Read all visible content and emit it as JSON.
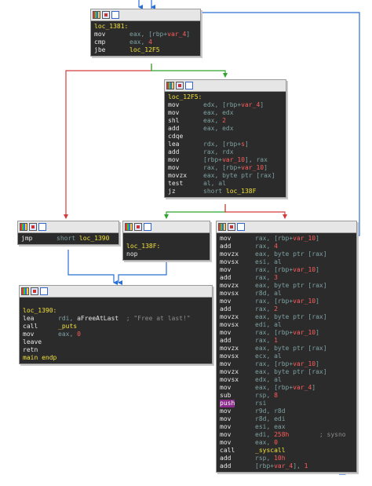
{
  "blocks": [
    {
      "id": "loc_1381",
      "lines": [
        {
          "t": "label",
          "text": "loc_1381:"
        },
        {
          "m": "mov",
          "o": [
            [
              "op",
              "eax, [rbp+"
            ],
            [
              "vr",
              "var_4"
            ],
            [
              "op",
              "]"
            ]
          ]
        },
        {
          "m": "cmp",
          "o": [
            [
              "op",
              "eax, "
            ],
            [
              "nm",
              "4"
            ]
          ]
        },
        {
          "m": "jbe",
          "o": [
            [
              "fn",
              "loc_12F5"
            ]
          ]
        }
      ]
    },
    {
      "id": "loc_12F5",
      "lines": [
        {
          "t": "label",
          "text": "loc_12F5:"
        },
        {
          "m": "mov",
          "o": [
            [
              "op",
              "edx, [rbp+"
            ],
            [
              "vr",
              "var_4"
            ],
            [
              "op",
              "]"
            ]
          ]
        },
        {
          "m": "mov",
          "o": [
            [
              "op",
              "eax, edx"
            ]
          ]
        },
        {
          "m": "shl",
          "o": [
            [
              "op",
              "eax, "
            ],
            [
              "nm",
              "2"
            ]
          ]
        },
        {
          "m": "add",
          "o": [
            [
              "op",
              "eax, edx"
            ]
          ]
        },
        {
          "m": "cdqe",
          "o": []
        },
        {
          "m": "lea",
          "o": [
            [
              "op",
              "rdx, [rbp+"
            ],
            [
              "vr",
              "s"
            ],
            [
              "op",
              "]"
            ]
          ]
        },
        {
          "m": "add",
          "o": [
            [
              "op",
              "rax, rdx"
            ]
          ]
        },
        {
          "m": "mov",
          "o": [
            [
              "op",
              "[rbp+"
            ],
            [
              "vr",
              "var_10"
            ],
            [
              "op",
              "], rax"
            ]
          ]
        },
        {
          "m": "mov",
          "o": [
            [
              "op",
              "rax, [rbp+"
            ],
            [
              "vr",
              "var_10"
            ],
            [
              "op",
              "]"
            ]
          ]
        },
        {
          "m": "movzx",
          "o": [
            [
              "op",
              "eax, byte ptr [rax]"
            ]
          ]
        },
        {
          "m": "test",
          "o": [
            [
              "op",
              "al, al"
            ]
          ]
        },
        {
          "m": "jz",
          "o": [
            [
              "op",
              "short "
            ],
            [
              "fn",
              "loc_138F"
            ]
          ]
        }
      ]
    },
    {
      "id": "jmp_1390",
      "lines": [
        {
          "m": "jmp",
          "o": [
            [
              "op",
              "short "
            ],
            [
              "fn",
              "loc_1390"
            ]
          ]
        }
      ]
    },
    {
      "id": "loc_138F",
      "lines": [
        {
          "t": "blank"
        },
        {
          "t": "label",
          "text": "loc_138F:"
        },
        {
          "m": "nop",
          "o": []
        }
      ]
    },
    {
      "id": "loc_1390",
      "lines": [
        {
          "t": "blank"
        },
        {
          "t": "label",
          "text": "loc_1390:"
        },
        {
          "m": "lea",
          "o": [
            [
              "op",
              "rdi, "
            ],
            [
              "st",
              "aFreeAtLast"
            ],
            [
              "cm",
              "  ; \"Free at last!\""
            ]
          ]
        },
        {
          "m": "call",
          "o": [
            [
              "fn",
              "_puts"
            ]
          ]
        },
        {
          "m": "mov",
          "o": [
            [
              "op",
              "eax, "
            ],
            [
              "nm",
              "0"
            ]
          ]
        },
        {
          "m": "leave",
          "o": []
        },
        {
          "m": "retn",
          "o": []
        },
        {
          "t": "label",
          "text": "main endp"
        }
      ]
    },
    {
      "id": "syscall_block",
      "lines": [
        {
          "m": "mov",
          "o": [
            [
              "op",
              "rax, [rbp+"
            ],
            [
              "vr",
              "var_10"
            ],
            [
              "op",
              "]"
            ]
          ]
        },
        {
          "m": "add",
          "o": [
            [
              "op",
              "rax, "
            ],
            [
              "nm",
              "4"
            ]
          ]
        },
        {
          "m": "movzx",
          "o": [
            [
              "op",
              "eax, byte ptr [rax]"
            ]
          ]
        },
        {
          "m": "movsx",
          "o": [
            [
              "op",
              "esi, al"
            ]
          ]
        },
        {
          "m": "mov",
          "o": [
            [
              "op",
              "rax, [rbp+"
            ],
            [
              "vr",
              "var_10"
            ],
            [
              "op",
              "]"
            ]
          ]
        },
        {
          "m": "add",
          "o": [
            [
              "op",
              "rax, "
            ],
            [
              "nm",
              "3"
            ]
          ]
        },
        {
          "m": "movzx",
          "o": [
            [
              "op",
              "eax, byte ptr [rax]"
            ]
          ]
        },
        {
          "m": "movsx",
          "o": [
            [
              "op",
              "r8d, al"
            ]
          ]
        },
        {
          "m": "mov",
          "o": [
            [
              "op",
              "rax, [rbp+"
            ],
            [
              "vr",
              "var_10"
            ],
            [
              "op",
              "]"
            ]
          ]
        },
        {
          "m": "add",
          "o": [
            [
              "op",
              "rax, "
            ],
            [
              "nm",
              "2"
            ]
          ]
        },
        {
          "m": "movzx",
          "o": [
            [
              "op",
              "eax, byte ptr [rax]"
            ]
          ]
        },
        {
          "m": "movsx",
          "o": [
            [
              "op",
              "edi, al"
            ]
          ]
        },
        {
          "m": "mov",
          "o": [
            [
              "op",
              "rax, [rbp+"
            ],
            [
              "vr",
              "var_10"
            ],
            [
              "op",
              "]"
            ]
          ]
        },
        {
          "m": "add",
          "o": [
            [
              "op",
              "rax, "
            ],
            [
              "nm",
              "1"
            ]
          ]
        },
        {
          "m": "movzx",
          "o": [
            [
              "op",
              "eax, byte ptr [rax]"
            ]
          ]
        },
        {
          "m": "movsx",
          "o": [
            [
              "op",
              "ecx, al"
            ]
          ]
        },
        {
          "m": "mov",
          "o": [
            [
              "op",
              "rax, [rbp+"
            ],
            [
              "vr",
              "var_10"
            ],
            [
              "op",
              "]"
            ]
          ]
        },
        {
          "m": "movzx",
          "o": [
            [
              "op",
              "eax, byte ptr [rax]"
            ]
          ]
        },
        {
          "m": "movsx",
          "o": [
            [
              "op",
              "edx, al"
            ]
          ]
        },
        {
          "m": "mov",
          "o": [
            [
              "op",
              "eax, [rbp+"
            ],
            [
              "vr",
              "var_4"
            ],
            [
              "op",
              "]"
            ]
          ]
        },
        {
          "m": "sub",
          "o": [
            [
              "op",
              "rsp, "
            ],
            [
              "nm",
              "8"
            ]
          ]
        },
        {
          "m": "push",
          "hl": true,
          "o": [
            [
              "op",
              "rsi"
            ]
          ]
        },
        {
          "m": "mov",
          "o": [
            [
              "op",
              "r9d, r8d"
            ]
          ]
        },
        {
          "m": "mov",
          "o": [
            [
              "op",
              "r8d, edi"
            ]
          ]
        },
        {
          "m": "mov",
          "o": [
            [
              "op",
              "esi, eax"
            ]
          ]
        },
        {
          "m": "mov",
          "o": [
            [
              "op",
              "edi, "
            ],
            [
              "nm",
              "258h"
            ],
            [
              "cm",
              "        ; sysno"
            ]
          ]
        },
        {
          "m": "mov",
          "o": [
            [
              "op",
              "eax, "
            ],
            [
              "nm",
              "0"
            ]
          ]
        },
        {
          "m": "call",
          "o": [
            [
              "fn",
              "_syscall"
            ]
          ]
        },
        {
          "m": "add",
          "o": [
            [
              "op",
              "rsp, "
            ],
            [
              "nm",
              "10h"
            ]
          ]
        },
        {
          "m": "add",
          "o": [
            [
              "op",
              "[rbp+"
            ],
            [
              "vr",
              "var_4"
            ],
            [
              "op",
              "], "
            ],
            [
              "nm",
              "1"
            ]
          ]
        }
      ]
    }
  ],
  "icons": [
    "color-icon",
    "graph-icon",
    "list-icon"
  ],
  "colors": {
    "true_edge": "#2fa52f",
    "false_edge": "#d43b3b",
    "uncond_edge": "#2a6fd4"
  }
}
